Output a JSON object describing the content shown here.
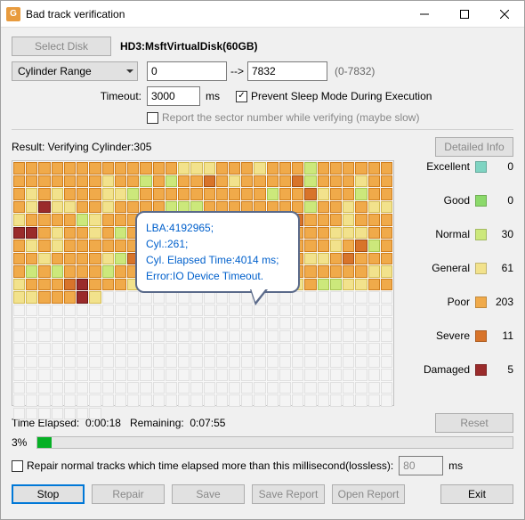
{
  "window": {
    "title": "Bad track verification"
  },
  "toolbar": {
    "select_disk": "Select Disk",
    "disk_name": "HD3:MsftVirtualDisk(60GB)"
  },
  "range": {
    "mode_label": "Cylinder Range",
    "from": "0",
    "to": "7832",
    "hint": "(0-7832)",
    "arrow": "-->"
  },
  "timeout": {
    "label": "Timeout:",
    "value": "3000",
    "unit": "ms",
    "prevent_sleep": "Prevent Sleep Mode During Execution",
    "report_sector": "Report the sector number while verifying (maybe slow)"
  },
  "result": {
    "label": "Result:  Verifying Cylinder:305",
    "detailed": "Detailed Info"
  },
  "tooltip": {
    "l1": "LBA:4192965;",
    "l2": "Cyl.:261;",
    "l3": "Cyl. Elapsed Time:4014 ms;",
    "l4": "Error:IO Device Timeout."
  },
  "legend": {
    "excellent": {
      "label": "Excellent",
      "value": "0"
    },
    "good": {
      "label": "Good",
      "value": "0"
    },
    "normal": {
      "label": "Normal",
      "value": "30"
    },
    "general": {
      "label": "General",
      "value": "61"
    },
    "poor": {
      "label": "Poor",
      "value": "203"
    },
    "severe": {
      "label": "Severe",
      "value": "11"
    },
    "damaged": {
      "label": "Damaged",
      "value": "5"
    }
  },
  "time": {
    "elapsed_label": "Time Elapsed:",
    "elapsed": "0:00:18",
    "remaining_label": "Remaining:",
    "remaining": "0:07:55",
    "reset": "Reset"
  },
  "progress": {
    "pct": "3%"
  },
  "repair": {
    "label": "Repair normal tracks which time elapsed more than this millisecond(lossless):",
    "value": "80",
    "unit": "ms"
  },
  "buttons": {
    "stop": "Stop",
    "repair": "Repair",
    "save": "Save",
    "save_report": "Save Report",
    "open_report": "Open Report",
    "exit": "Exit"
  },
  "grid_pattern": "pppppppppppppgggpppgpppnpppppppppppppgppnpnppspgppppsnpppgpppgpgpppggnppppppppppnppsgppnpppgdggppgppppnnnppppppppnppgpgggppppngpppgpppgnpppnppspppgpppddpgppgpnppppgggnpppngpppgggpppgpgpppppppppgggpppppppppgpsnpppgppppgnsppnnpggppgsspggpsppppnpnpppnppnnnppppppsggppppppgggpppsdpppgppgppgggggpngpnnggppggpppdgeeeeeeeeeeeeeeeeeeeeeeeeeeeeeeeeeeeeeeeeeeeeeeeeeeeeeeeeeeeeeeeeeeeeeeeeeeeeeeeeeeeeeeeeeeeeeeeeeeeeeeeeeeeeeeeeeeeeeeeeeeeeeeeeeeeeeeeeeeeeeeeeeeeeeeeeeeeeeeeeeeeeeeeeeeeeeeeeeeeeeeeeeeeeeeeeeeeeeeeeeeeeeeeeeeeeeeeeeeeeeeeeeeeeeeeeeeeeeeeeeeeeeeeeeeeeeeeeeeeeeeeeeeeeee"
}
